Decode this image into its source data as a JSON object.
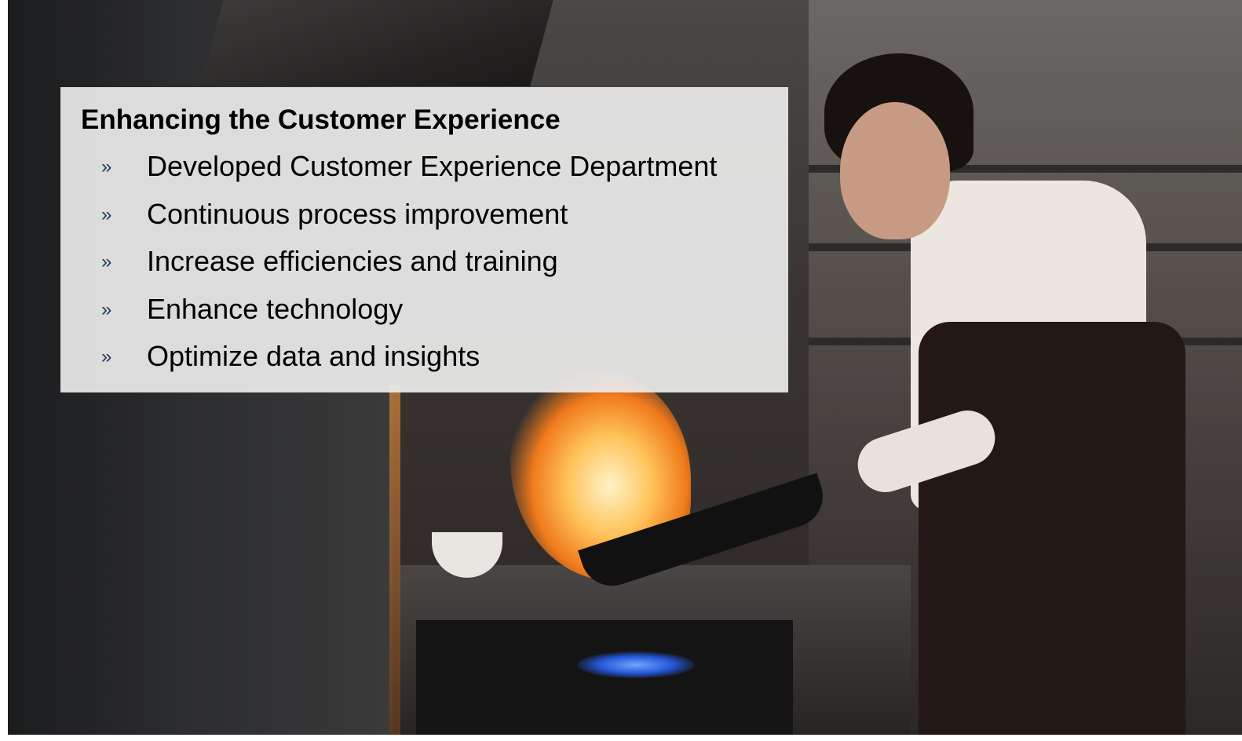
{
  "slide": {
    "title": "Enhancing the Customer Experience",
    "bullet_marker": "»",
    "bullets": [
      "Developed Customer Experience Department",
      "Continuous process improvement",
      "Increase efficiencies and training",
      "Enhance technology",
      "Optimize data and insights"
    ]
  },
  "background_image": {
    "subject": "chef-flambe-kitchen-photo"
  },
  "colors": {
    "panel": "#ebebeb",
    "title_text": "#000000",
    "bullet_marker": "#1f3a60"
  }
}
